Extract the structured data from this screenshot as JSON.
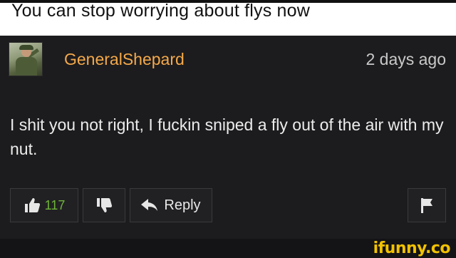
{
  "caption": "You can stop worrying about flys now",
  "comment": {
    "username": "GeneralShepard",
    "timestamp": "2 days ago",
    "body": "I shit you not right, I fuckin sniped a fly out of the air with my nut.",
    "likes": "117",
    "reply_label": "Reply"
  },
  "colors": {
    "username": "#f5a94a",
    "like_count": "#6fb33a",
    "background": "#1c1c1e",
    "watermark": "#f2c200"
  },
  "icons": {
    "like": "thumbs-up-icon",
    "dislike": "thumbs-down-icon",
    "reply": "reply-arrow-icon",
    "flag": "flag-icon"
  },
  "watermark": "ifunny.co"
}
